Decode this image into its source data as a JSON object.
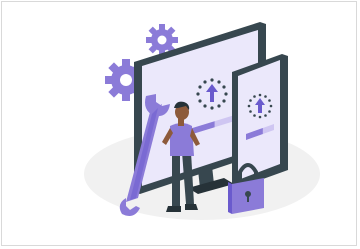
{
  "illustration": {
    "subject": "person-with-wrench-updating-devices",
    "colors": {
      "accent": "#8b7bd8",
      "accent_dark": "#6a5acd",
      "accent_light": "#cfc6f2",
      "device_frame": "#37474f",
      "device_frame_dark": "#263238",
      "floor_ellipse": "#f0f0f0",
      "screen_bg": "#ebe8fb",
      "skin": "#8d5a3b",
      "pants": "#37474f"
    },
    "icons": [
      "gear-icon",
      "wrench-icon",
      "padlock-icon",
      "upload-arrow-icon",
      "loading-spinner-icon"
    ],
    "progress": {
      "monitor_bar_fill": 0.55,
      "phone_bar_fill": 0.6
    }
  }
}
